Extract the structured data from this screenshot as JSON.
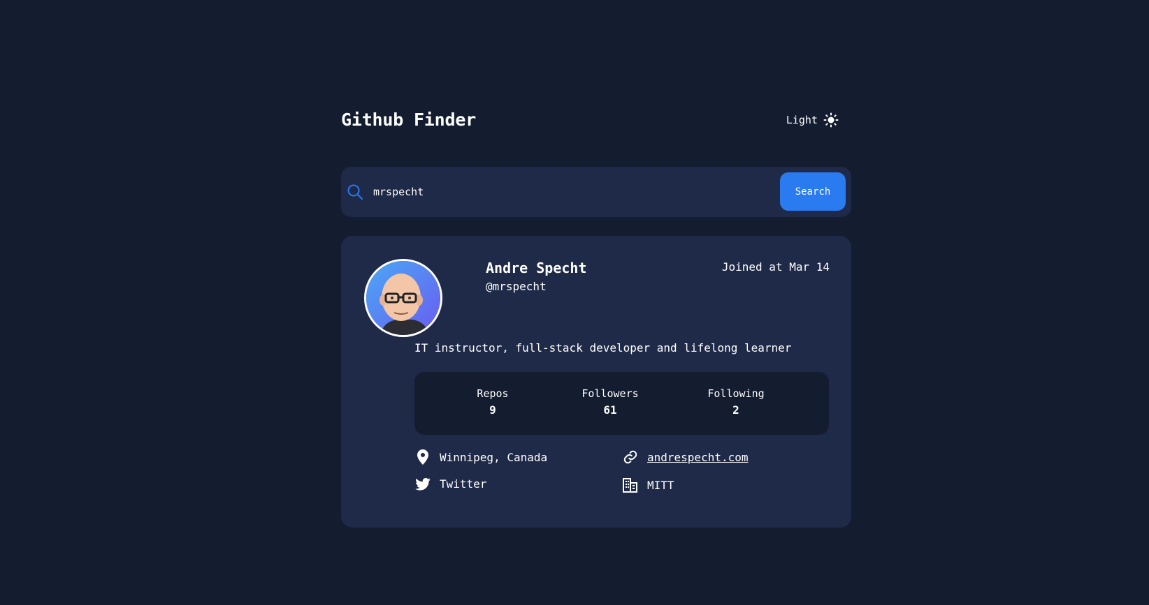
{
  "header": {
    "title": "Github Finder",
    "theme_toggle_label": "Light",
    "theme_icon": "sun-icon"
  },
  "search": {
    "icon": "search-icon",
    "value": "mrspecht",
    "placeholder": "",
    "button_label": "Search"
  },
  "profile": {
    "avatar_icon": "avatar-image",
    "name": "Andre Specht",
    "login": "@mrspecht",
    "joined": "Joined at Mar 14",
    "bio": "IT instructor, full-stack developer and lifelong learner",
    "stats": {
      "repos_label": "Repos",
      "repos_value": "9",
      "followers_label": "Followers",
      "followers_value": "61",
      "following_label": "Following",
      "following_value": "2"
    },
    "links": {
      "location": "Winnipeg, Canada",
      "blog": "andrespecht.com",
      "twitter": "Twitter",
      "company": "MITT"
    }
  },
  "colors": {
    "background": "#141c2f",
    "card": "#1f2a48",
    "accent": "#2b7bf0",
    "text": "#ffffff"
  }
}
